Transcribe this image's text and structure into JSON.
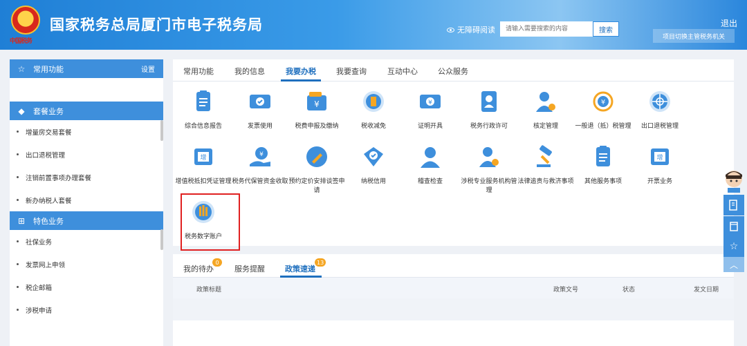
{
  "header": {
    "emblem_text": "中国税务",
    "title": "国家税务总局厦门市电子税务局",
    "accessibility": "无障碍阅读",
    "search_placeholder": "请输入需要搜索的内容",
    "search_button": "搜索",
    "logout": "退出",
    "switch_button": "项目切换主管税务机关"
  },
  "sidebar": {
    "common": {
      "title": "常用功能",
      "settings": "设置"
    },
    "package": {
      "title": "套餐业务",
      "items": [
        "增量房交易套餐",
        "出口退税管理",
        "注销前置事项办理套餐",
        "新办纳税人套餐"
      ]
    },
    "special": {
      "title": "特色业务",
      "items": [
        "社保业务",
        "发票网上申领",
        "税企邮箱",
        "涉税申请"
      ]
    }
  },
  "main": {
    "tabs": [
      "常用功能",
      "我的信息",
      "我要办税",
      "我要查询",
      "互动中心",
      "公众服务"
    ],
    "active_tab": "我要办税",
    "grid": [
      {
        "label": "综合信息报告",
        "icon": "document-list-icon",
        "color": "#3e8fdc"
      },
      {
        "label": "发票使用",
        "icon": "invoice-ticket-icon",
        "color": "#3e8fdc"
      },
      {
        "label": "税费申报及缴纳",
        "icon": "yuan-wallet-icon",
        "color": "#3e8fdc"
      },
      {
        "label": "税收减免",
        "icon": "coin-stack-icon",
        "color": "#3e8fdc"
      },
      {
        "label": "证明开具",
        "icon": "yuan-ticket-icon",
        "color": "#3e8fdc"
      },
      {
        "label": "税务行政许可",
        "icon": "id-card-icon",
        "color": "#3e8fdc"
      },
      {
        "label": "核定管理",
        "icon": "user-gear-icon",
        "color": "#3e8fdc"
      },
      {
        "label": "一般退（抵）税管理",
        "icon": "yuan-refresh-icon",
        "color": "#f5a623"
      },
      {
        "label": "出口退税管理",
        "icon": "globe-icon",
        "color": "#3e8fdc"
      },
      {
        "label": "增值税抵扣凭证管理",
        "icon": "vat-stamp-icon",
        "color": "#3e8fdc"
      },
      {
        "label": "税务代保管资金收取",
        "icon": "money-bag-hand-icon",
        "color": "#3e8fdc"
      },
      {
        "label": "预约定价安排谈签申请",
        "icon": "pen-circle-icon",
        "color": "#3e8fdc"
      },
      {
        "label": "纳税信用",
        "icon": "diamond-check-icon",
        "color": "#3e8fdc"
      },
      {
        "label": "稽查检查",
        "icon": "inspector-user-icon",
        "color": "#3e8fdc"
      },
      {
        "label": "涉税专业服务机构管理",
        "icon": "agent-gear-icon",
        "color": "#3e8fdc"
      },
      {
        "label": "法律追责与救济事项",
        "icon": "gavel-icon",
        "color": "#3e8fdc"
      },
      {
        "label": "其他服务事项",
        "icon": "clipboard-icon",
        "color": "#3e8fdc"
      },
      {
        "label": "开票业务",
        "icon": "vat-invoice-icon",
        "color": "#3e8fdc"
      },
      {
        "label": "税务数字账户",
        "icon": "digital-account-icon",
        "color": "#3e8fdc"
      }
    ]
  },
  "bottom": {
    "tabs": [
      {
        "label": "我的待办",
        "badge": "0"
      },
      {
        "label": "服务提醒",
        "badge": ""
      },
      {
        "label": "政策速递",
        "badge": "13"
      }
    ],
    "active_tab": "政策速递",
    "columns": [
      "政策标题",
      "政策文号",
      "状态",
      "发文日期"
    ]
  },
  "colors": {
    "brand": "#3e8fdc",
    "accent": "#1e6fbe",
    "badge": "#f5a623",
    "highlight": "#e02020"
  }
}
